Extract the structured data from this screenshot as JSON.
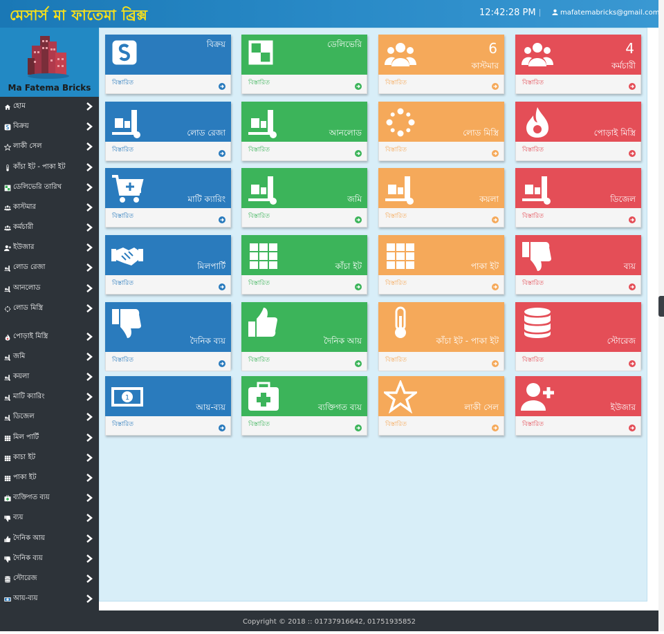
{
  "header": {
    "brand": "মেসার্স মা ফাতেমা ব্রিক্স",
    "clock": "12:42:28 PM",
    "user_email": "mafatemabricks@gmail.com"
  },
  "logo": {
    "caption": "Ma Fatema Bricks"
  },
  "sidebar": {
    "items": [
      {
        "label": "হোম",
        "icon": "home-icon"
      },
      {
        "label": "বিক্রয়",
        "icon": "sale-icon"
      },
      {
        "label": "লাকী সেল",
        "icon": "star-icon"
      },
      {
        "label": "কাঁচা ইট - পাকা ইট",
        "icon": "thermometer-icon"
      },
      {
        "label": "ডেলিভেরি তারিখ",
        "icon": "delivery-icon"
      },
      {
        "label": "কাস্টমার",
        "icon": "users-icon"
      },
      {
        "label": "কর্মচারী",
        "icon": "users-icon"
      },
      {
        "label": "ইউজার",
        "icon": "user-plus-icon"
      },
      {
        "label": "লোড রেজা",
        "icon": "dolly-icon"
      },
      {
        "label": "আনলোড",
        "icon": "dolly-icon"
      },
      {
        "label": "লোড মিস্ত্রি",
        "icon": "spinner-icon"
      },
      {
        "label": "পোড়াই মিস্ত্রি",
        "icon": "fire-icon"
      },
      {
        "label": "জমি",
        "icon": "dolly-icon"
      },
      {
        "label": "কয়লা",
        "icon": "dolly-icon"
      },
      {
        "label": "মাটি ক্যারিং",
        "icon": "dolly-icon"
      },
      {
        "label": "ডিজেল",
        "icon": "dolly-icon"
      },
      {
        "label": "মিল পার্টি",
        "icon": "grid-icon"
      },
      {
        "label": "কাচা ইট",
        "icon": "grid-icon"
      },
      {
        "label": "পাকা ইট",
        "icon": "grid-icon"
      },
      {
        "label": "ব্যক্তিগত ব্যয়",
        "icon": "medkit-icon"
      },
      {
        "label": "ব্যয়",
        "icon": "thumbs-down-icon"
      },
      {
        "label": "দৈনিক আয়",
        "icon": "thumbs-up-icon"
      },
      {
        "label": "দৈনিক ব্যয়",
        "icon": "thumbs-down-icon"
      },
      {
        "label": "স্টোরেজ",
        "icon": "database-icon"
      },
      {
        "label": "আয়-ব্যয়",
        "icon": "money-icon"
      }
    ]
  },
  "cards": [
    {
      "title": "বিক্রয়",
      "count": "",
      "icon": "sale-icon",
      "color": "blue"
    },
    {
      "title": "ডেলিভেরি",
      "count": "",
      "icon": "delivery-icon",
      "color": "green"
    },
    {
      "title": "কাস্টমার",
      "count": "6",
      "icon": "users-icon",
      "color": "orange"
    },
    {
      "title": "কর্মচারী",
      "count": "4",
      "icon": "users-icon",
      "color": "red"
    },
    {
      "title": "লোড রেজা",
      "count": "",
      "icon": "dolly-icon",
      "color": "blue"
    },
    {
      "title": "আনলোড",
      "count": "",
      "icon": "dolly-icon",
      "color": "green"
    },
    {
      "title": "লোড মিস্ত্রি",
      "count": "",
      "icon": "spinner-icon",
      "color": "orange"
    },
    {
      "title": "পোড়াই মিস্ত্রি",
      "count": "",
      "icon": "fire-icon",
      "color": "red"
    },
    {
      "title": "মাটি ক্যারিং",
      "count": "",
      "icon": "cart-plus-icon",
      "color": "blue"
    },
    {
      "title": "জমি",
      "count": "",
      "icon": "dolly-icon",
      "color": "green"
    },
    {
      "title": "কয়লা",
      "count": "",
      "icon": "dolly-icon",
      "color": "orange"
    },
    {
      "title": "ডিজেল",
      "count": "",
      "icon": "dolly-icon",
      "color": "red"
    },
    {
      "title": "মিলপার্টি",
      "count": "",
      "icon": "handshake-icon",
      "color": "blue"
    },
    {
      "title": "কাঁচা ইট",
      "count": "",
      "icon": "grid-icon",
      "color": "green"
    },
    {
      "title": "পাকা ইট",
      "count": "",
      "icon": "grid-icon",
      "color": "orange"
    },
    {
      "title": "ব্যয়",
      "count": "",
      "icon": "thumbs-down-icon",
      "color": "red"
    },
    {
      "title": "দৈনিক ব্যয়",
      "count": "",
      "icon": "thumbs-down-icon",
      "color": "blue"
    },
    {
      "title": "দৈনিক আয়",
      "count": "",
      "icon": "thumbs-up-icon",
      "color": "green"
    },
    {
      "title": "কাঁচা ইট - পাকা ইট",
      "count": "",
      "icon": "thermometer-icon",
      "color": "orange"
    },
    {
      "title": "স্টোরেজ",
      "count": "",
      "icon": "database-icon",
      "color": "red"
    },
    {
      "title": "আয়-ব্যয়",
      "count": "",
      "icon": "money-icon",
      "color": "blue"
    },
    {
      "title": "ব্যক্তিগত ব্যয়",
      "count": "",
      "icon": "medkit-icon",
      "color": "green"
    },
    {
      "title": "লাকী সেল",
      "count": "",
      "icon": "star-icon",
      "color": "orange"
    },
    {
      "title": "ইউজার",
      "count": "",
      "icon": "user-plus-icon",
      "color": "red"
    }
  ],
  "card_footer_label": "বিস্তারিত",
  "footer": {
    "copyright": "Copyright © 2018 :: 01737916642, 01751935852"
  }
}
